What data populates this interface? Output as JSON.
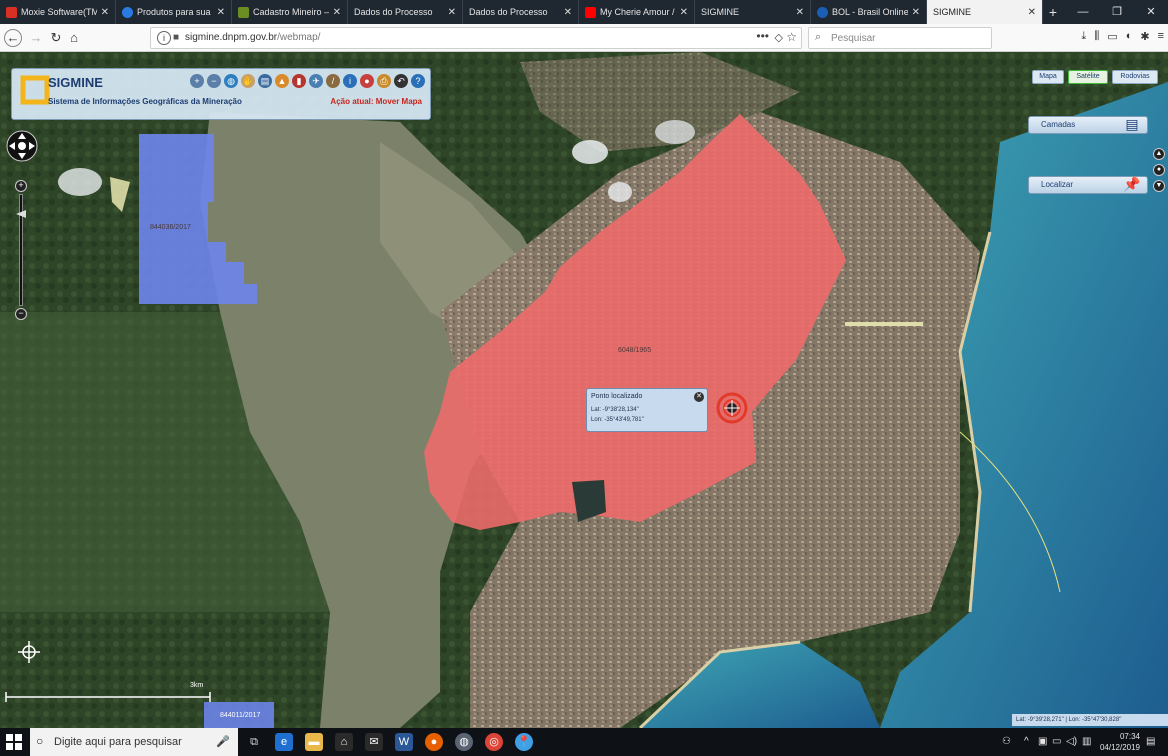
{
  "browser": {
    "tabs": [
      {
        "label": "Moxie Software(TM) Esp",
        "icon_color": "#d93025"
      },
      {
        "label": "Produtos para sua empr",
        "icon_color": "#2a7ae2"
      },
      {
        "label": "Cadastro Mineiro — Agê",
        "icon_color": "#6b8e23"
      },
      {
        "label": "Dados do Processo",
        "icon_color": ""
      },
      {
        "label": "Dados do Processo",
        "icon_color": ""
      },
      {
        "label": "My Cherie Amour / Stev",
        "icon_color": "#ff0000"
      },
      {
        "label": "SIGMINE",
        "icon_color": ""
      },
      {
        "label": "BOL - Brasil Online",
        "icon_color": "#1a5fb4"
      },
      {
        "label": "SIGMINE",
        "icon_color": "",
        "active": true
      }
    ],
    "new_tab": "+",
    "url_host": "sigmine.dnpm.gov.br",
    "url_path": "/webmap/",
    "search_placeholder": "Pesquisar"
  },
  "app": {
    "title": "SIGMINE",
    "subtitle": "Sistema de Informações Geográficas da Mineração",
    "current_action": "Ação atual: Mover Mapa",
    "tools": [
      "zoom-in-icon",
      "zoom-out-icon",
      "globe-icon",
      "hand-icon",
      "layers-icon",
      "chart-icon",
      "book-icon",
      "measure-icon",
      "ruler-icon",
      "info-icon",
      "pin-icon",
      "print-icon",
      "undo-icon",
      "help-icon"
    ]
  },
  "map_types": {
    "mapa": "Mapa",
    "satelite": "Satélite",
    "rodovias": "Rodovias",
    "active": "Satélite"
  },
  "side_buttons": {
    "camadas": "Camadas",
    "localizar": "Localizar"
  },
  "parcels": {
    "blue_label": "844036/2017",
    "red_label": "6048/1965",
    "bottom_label": "844011/2017"
  },
  "popup": {
    "title": "Ponto localizado",
    "lat": "Lat: -9°38'28,134\"",
    "lon": "Lon: -35°43'49,781\""
  },
  "scale": {
    "text": "3km"
  },
  "status": {
    "coords": "Lat: -9°39'28,271\" | Lon: -35°47'30,828\""
  },
  "taskbar": {
    "search_placeholder": "Digite aqui para pesquisar",
    "time": "07:34",
    "date": "04/12/2019"
  },
  "colors": {
    "red_parcel": "#f06b6b",
    "blue_parcel": "#6d84e8",
    "ui_blue": "#1d3d72",
    "action_red": "#c8261f"
  }
}
